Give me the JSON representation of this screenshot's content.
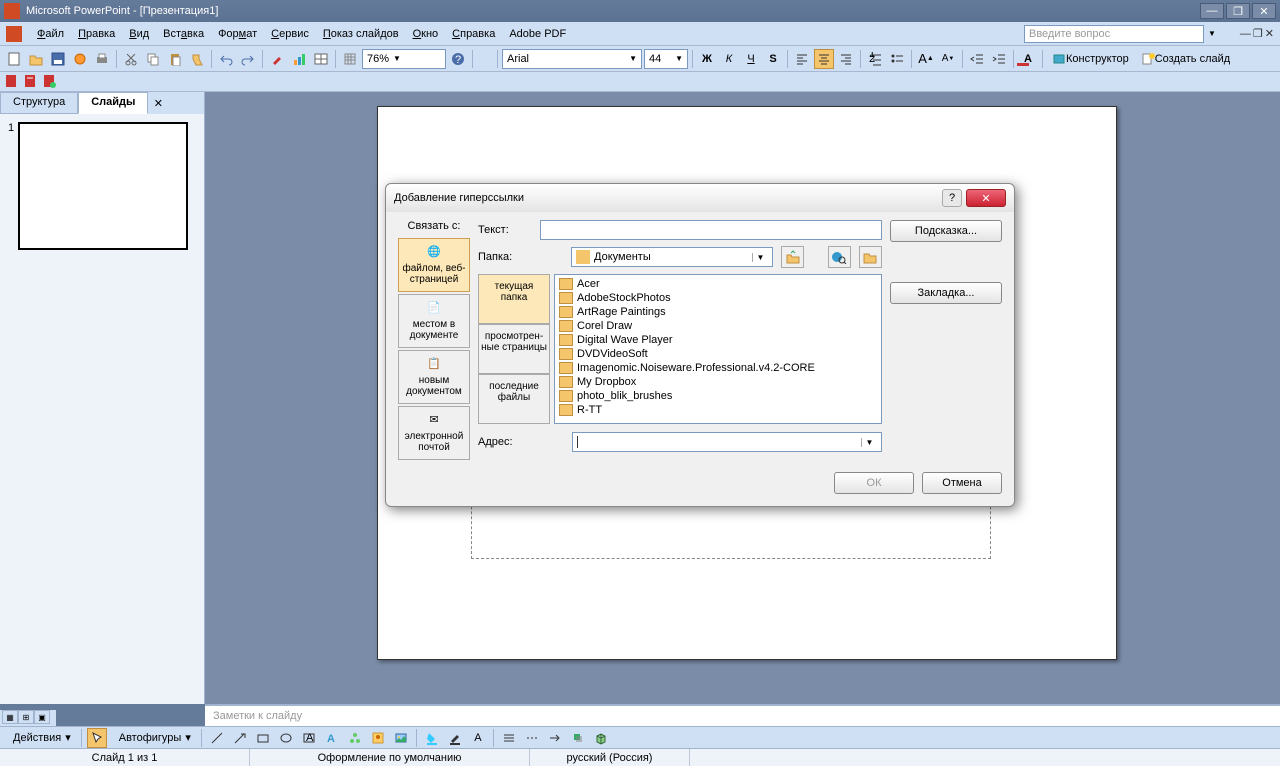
{
  "titlebar": {
    "title": "Microsoft PowerPoint - [Презентация1]"
  },
  "menubar": {
    "items": [
      "Файл",
      "Правка",
      "Вид",
      "Вставка",
      "Формат",
      "Сервис",
      "Показ слайдов",
      "Окно",
      "Справка",
      "Adobe PDF"
    ],
    "underlines": [
      0,
      0,
      0,
      3,
      3,
      0,
      0,
      0,
      0,
      -1
    ],
    "help_placeholder": "Введите вопрос"
  },
  "toolbar": {
    "zoom": "76%",
    "font": "Arial",
    "fontsize": "44",
    "constructor": "Конструктор",
    "new_slide": "Создать слайд"
  },
  "tabs": {
    "outline": "Структура",
    "slides": "Слайды"
  },
  "thumb": {
    "num": "1"
  },
  "notes": {
    "placeholder": "Заметки к слайду"
  },
  "drawtb": {
    "actions": "Действия",
    "autoshapes": "Автофигуры"
  },
  "status": {
    "slide": "Слайд 1 из 1",
    "design": "Оформление по умолчанию",
    "lang": "русский (Россия)"
  },
  "dialog": {
    "title": "Добавление гиперссылки",
    "link_with": "Связать с:",
    "text_label": "Текст:",
    "hint_btn": "Подсказка...",
    "folder_label": "Папка:",
    "folder_value": "Документы",
    "bookmark_btn": "Закладка...",
    "address_label": "Адрес:",
    "ok_btn": "ОК",
    "cancel_btn": "Отмена",
    "link_opts": [
      "файлом, веб-страницей",
      "местом в документе",
      "новым документом",
      "электронной почтой"
    ],
    "nav_opts": [
      "текущая папка",
      "просмотрен-ные страницы",
      "последние файлы"
    ],
    "files": [
      "Acer",
      "AdobeStockPhotos",
      "ArtRage Paintings",
      "Corel Draw",
      "Digital Wave Player",
      "DVDVideoSoft",
      "Imagenomic.Noiseware.Professional.v4.2-CORE",
      "My Dropbox",
      "photo_blik_brushes",
      "R-TT"
    ]
  }
}
